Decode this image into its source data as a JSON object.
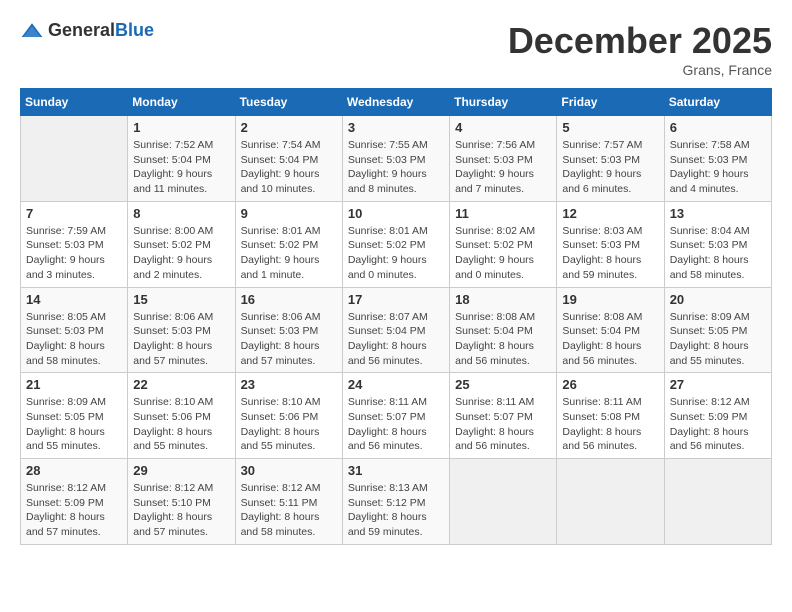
{
  "logo": {
    "general": "General",
    "blue": "Blue"
  },
  "title": "December 2025",
  "location": "Grans, France",
  "days_header": [
    "Sunday",
    "Monday",
    "Tuesday",
    "Wednesday",
    "Thursday",
    "Friday",
    "Saturday"
  ],
  "weeks": [
    [
      {
        "day": "",
        "sunrise": "",
        "sunset": "",
        "daylight": ""
      },
      {
        "day": "1",
        "sunrise": "Sunrise: 7:52 AM",
        "sunset": "Sunset: 5:04 PM",
        "daylight": "Daylight: 9 hours and 11 minutes."
      },
      {
        "day": "2",
        "sunrise": "Sunrise: 7:54 AM",
        "sunset": "Sunset: 5:04 PM",
        "daylight": "Daylight: 9 hours and 10 minutes."
      },
      {
        "day": "3",
        "sunrise": "Sunrise: 7:55 AM",
        "sunset": "Sunset: 5:03 PM",
        "daylight": "Daylight: 9 hours and 8 minutes."
      },
      {
        "day": "4",
        "sunrise": "Sunrise: 7:56 AM",
        "sunset": "Sunset: 5:03 PM",
        "daylight": "Daylight: 9 hours and 7 minutes."
      },
      {
        "day": "5",
        "sunrise": "Sunrise: 7:57 AM",
        "sunset": "Sunset: 5:03 PM",
        "daylight": "Daylight: 9 hours and 6 minutes."
      },
      {
        "day": "6",
        "sunrise": "Sunrise: 7:58 AM",
        "sunset": "Sunset: 5:03 PM",
        "daylight": "Daylight: 9 hours and 4 minutes."
      }
    ],
    [
      {
        "day": "7",
        "sunrise": "Sunrise: 7:59 AM",
        "sunset": "Sunset: 5:03 PM",
        "daylight": "Daylight: 9 hours and 3 minutes."
      },
      {
        "day": "8",
        "sunrise": "Sunrise: 8:00 AM",
        "sunset": "Sunset: 5:02 PM",
        "daylight": "Daylight: 9 hours and 2 minutes."
      },
      {
        "day": "9",
        "sunrise": "Sunrise: 8:01 AM",
        "sunset": "Sunset: 5:02 PM",
        "daylight": "Daylight: 9 hours and 1 minute."
      },
      {
        "day": "10",
        "sunrise": "Sunrise: 8:01 AM",
        "sunset": "Sunset: 5:02 PM",
        "daylight": "Daylight: 9 hours and 0 minutes."
      },
      {
        "day": "11",
        "sunrise": "Sunrise: 8:02 AM",
        "sunset": "Sunset: 5:02 PM",
        "daylight": "Daylight: 9 hours and 0 minutes."
      },
      {
        "day": "12",
        "sunrise": "Sunrise: 8:03 AM",
        "sunset": "Sunset: 5:03 PM",
        "daylight": "Daylight: 8 hours and 59 minutes."
      },
      {
        "day": "13",
        "sunrise": "Sunrise: 8:04 AM",
        "sunset": "Sunset: 5:03 PM",
        "daylight": "Daylight: 8 hours and 58 minutes."
      }
    ],
    [
      {
        "day": "14",
        "sunrise": "Sunrise: 8:05 AM",
        "sunset": "Sunset: 5:03 PM",
        "daylight": "Daylight: 8 hours and 58 minutes."
      },
      {
        "day": "15",
        "sunrise": "Sunrise: 8:06 AM",
        "sunset": "Sunset: 5:03 PM",
        "daylight": "Daylight: 8 hours and 57 minutes."
      },
      {
        "day": "16",
        "sunrise": "Sunrise: 8:06 AM",
        "sunset": "Sunset: 5:03 PM",
        "daylight": "Daylight: 8 hours and 57 minutes."
      },
      {
        "day": "17",
        "sunrise": "Sunrise: 8:07 AM",
        "sunset": "Sunset: 5:04 PM",
        "daylight": "Daylight: 8 hours and 56 minutes."
      },
      {
        "day": "18",
        "sunrise": "Sunrise: 8:08 AM",
        "sunset": "Sunset: 5:04 PM",
        "daylight": "Daylight: 8 hours and 56 minutes."
      },
      {
        "day": "19",
        "sunrise": "Sunrise: 8:08 AM",
        "sunset": "Sunset: 5:04 PM",
        "daylight": "Daylight: 8 hours and 56 minutes."
      },
      {
        "day": "20",
        "sunrise": "Sunrise: 8:09 AM",
        "sunset": "Sunset: 5:05 PM",
        "daylight": "Daylight: 8 hours and 55 minutes."
      }
    ],
    [
      {
        "day": "21",
        "sunrise": "Sunrise: 8:09 AM",
        "sunset": "Sunset: 5:05 PM",
        "daylight": "Daylight: 8 hours and 55 minutes."
      },
      {
        "day": "22",
        "sunrise": "Sunrise: 8:10 AM",
        "sunset": "Sunset: 5:06 PM",
        "daylight": "Daylight: 8 hours and 55 minutes."
      },
      {
        "day": "23",
        "sunrise": "Sunrise: 8:10 AM",
        "sunset": "Sunset: 5:06 PM",
        "daylight": "Daylight: 8 hours and 55 minutes."
      },
      {
        "day": "24",
        "sunrise": "Sunrise: 8:11 AM",
        "sunset": "Sunset: 5:07 PM",
        "daylight": "Daylight: 8 hours and 56 minutes."
      },
      {
        "day": "25",
        "sunrise": "Sunrise: 8:11 AM",
        "sunset": "Sunset: 5:07 PM",
        "daylight": "Daylight: 8 hours and 56 minutes."
      },
      {
        "day": "26",
        "sunrise": "Sunrise: 8:11 AM",
        "sunset": "Sunset: 5:08 PM",
        "daylight": "Daylight: 8 hours and 56 minutes."
      },
      {
        "day": "27",
        "sunrise": "Sunrise: 8:12 AM",
        "sunset": "Sunset: 5:09 PM",
        "daylight": "Daylight: 8 hours and 56 minutes."
      }
    ],
    [
      {
        "day": "28",
        "sunrise": "Sunrise: 8:12 AM",
        "sunset": "Sunset: 5:09 PM",
        "daylight": "Daylight: 8 hours and 57 minutes."
      },
      {
        "day": "29",
        "sunrise": "Sunrise: 8:12 AM",
        "sunset": "Sunset: 5:10 PM",
        "daylight": "Daylight: 8 hours and 57 minutes."
      },
      {
        "day": "30",
        "sunrise": "Sunrise: 8:12 AM",
        "sunset": "Sunset: 5:11 PM",
        "daylight": "Daylight: 8 hours and 58 minutes."
      },
      {
        "day": "31",
        "sunrise": "Sunrise: 8:13 AM",
        "sunset": "Sunset: 5:12 PM",
        "daylight": "Daylight: 8 hours and 59 minutes."
      },
      {
        "day": "",
        "sunrise": "",
        "sunset": "",
        "daylight": ""
      },
      {
        "day": "",
        "sunrise": "",
        "sunset": "",
        "daylight": ""
      },
      {
        "day": "",
        "sunrise": "",
        "sunset": "",
        "daylight": ""
      }
    ]
  ]
}
